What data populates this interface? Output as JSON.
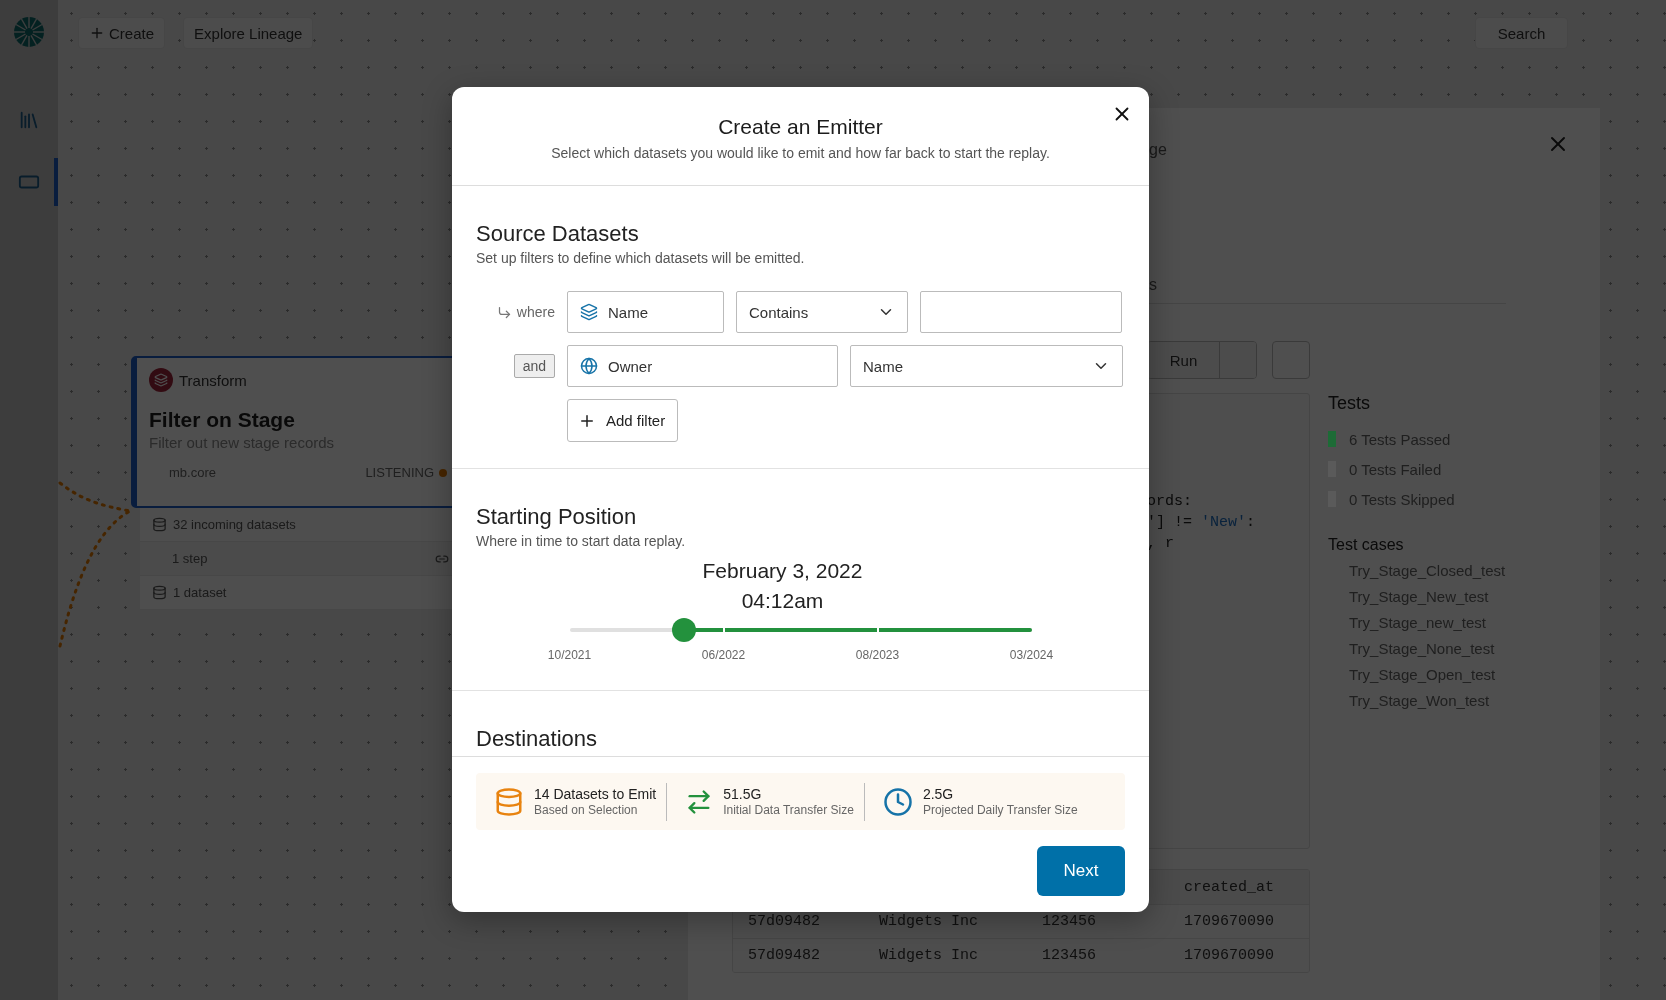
{
  "sidebar": {
    "items": [
      {
        "selected": false
      },
      {
        "selected": true
      }
    ]
  },
  "toolbar": {
    "buttons": [
      {
        "label": "Create",
        "kind": "add"
      },
      {
        "label": "Explore Lineage",
        "kind": "plain"
      }
    ],
    "search": "Search"
  },
  "canvas": {
    "node": {
      "type": "Transform",
      "title": "Filter on Stage",
      "description": "Filter out new stage records",
      "source": "mb.core",
      "status": "LISTENING",
      "rows": [
        {
          "label": "32 incoming datasets",
          "kind": "datasets"
        },
        {
          "label": "1 step",
          "kind": "steps"
        },
        {
          "label": "1 dataset",
          "kind": "datasets"
        }
      ]
    }
  },
  "drawer": {
    "title": "ge",
    "subtitle": "s",
    "run_button": "Run",
    "code_lines": [
      {
        "text": "ords:"
      },
      {
        "text": "'] != **'New'**:"
      },
      {
        "text": ", r"
      }
    ],
    "tests": {
      "title": "Tests",
      "results": [
        {
          "label": "6 Tests Passed",
          "color": "#1d6b36"
        },
        {
          "label": "0 Tests Failed",
          "color": "#5a5a5a"
        },
        {
          "label": "0 Tests Skipped",
          "color": "#5a5a5a"
        }
      ],
      "cases_title": "Test cases",
      "cases": [
        "Try_Stage_Closed_test",
        "Try_Stage_New_test",
        "Try_Stage_new_test",
        "Try_Stage_None_test",
        "Try_Stage_Open_test",
        "Try_Stage_Won_test"
      ]
    },
    "table": {
      "column_4": "created_at",
      "rows": [
        [
          "57d09482",
          "Widgets Inc",
          "123456",
          "1709670090"
        ],
        [
          "57d09482",
          "Widgets Inc",
          "123456",
          "1709670090"
        ]
      ]
    }
  },
  "modal": {
    "title": "Create an Emitter",
    "subtitle": "Select which datasets you would like to emit and how far back to start the replay.",
    "source": {
      "title": "Source Datasets",
      "subtitle": "Set up filters to define which datasets will be emitted.",
      "filters": [
        {
          "kind": "text-match",
          "connector": "where",
          "field": "Name",
          "operator": "Contains"
        },
        {
          "kind": "owner-match",
          "connector": "and",
          "field": "Owner",
          "operator": "Name"
        }
      ],
      "add_button": "Add filter"
    },
    "starting_position": {
      "title": "Starting Position",
      "subtitle": "Where in time to start data replay.",
      "date": "February 3, 2022",
      "time": "04:12am",
      "level": 0.247,
      "ticks": [
        "10/2021",
        "06/2022",
        "08/2023",
        "03/2024"
      ]
    },
    "destinations": {
      "title": "Destinations"
    },
    "summary": [
      {
        "kind": "datasets",
        "value": "14 Datasets to Emit",
        "caption": "Based on Selection"
      },
      {
        "kind": "transfer",
        "value": "51.5G",
        "caption": "Initial Data Transfer Size"
      },
      {
        "kind": "schedule",
        "value": "2.5G",
        "caption": "Projected Daily Transfer Size"
      }
    ],
    "next_button": "Next"
  }
}
